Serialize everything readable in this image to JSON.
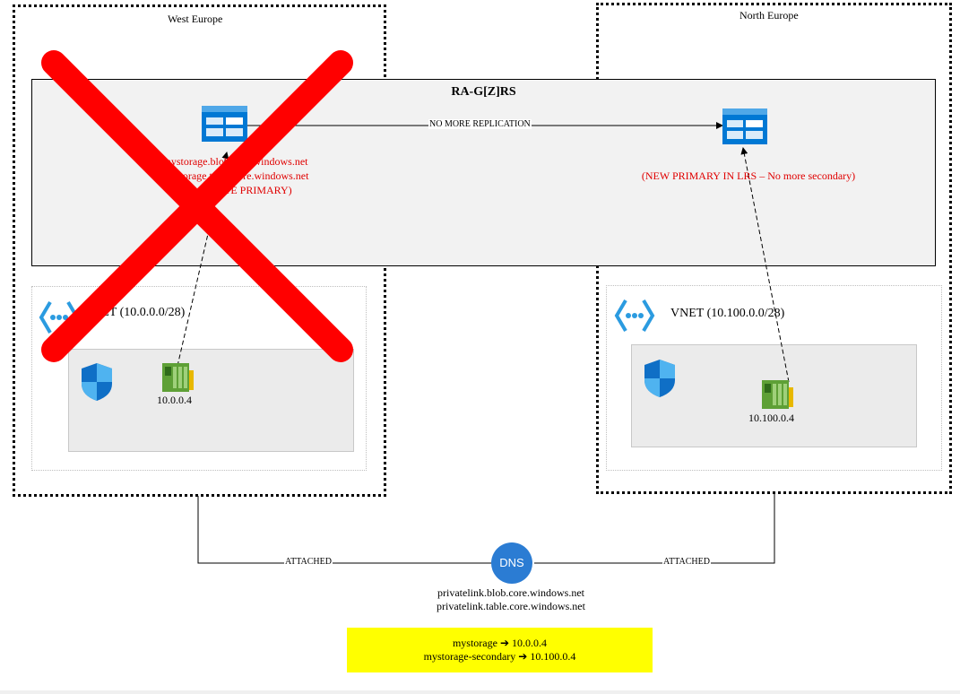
{
  "regions": {
    "west": {
      "label": "West Europe"
    },
    "north": {
      "label": "North Europe"
    }
  },
  "replication": {
    "title": "RA-G[Z]RS",
    "link_label": "NO MORE REPLICATION"
  },
  "west_storage": {
    "lines": [
      "mystorage.blob.core.windows.net",
      "mystorage.table.core.windows.net",
      "(OBSOLETE PRIMARY)"
    ]
  },
  "north_storage": {
    "status": "(NEW PRIMARY IN LRS – No more secondary)"
  },
  "west_vnet": {
    "label": "VNET (10.0.0.0/28)",
    "nic_ip": "10.0.0.4"
  },
  "north_vnet": {
    "label": "VNET (10.100.0.0/28)",
    "nic_ip": "10.100.0.4"
  },
  "dns": {
    "icon_text": "DNS",
    "attached_left": "ATTACHED",
    "attached_right": "ATTACHED",
    "zones": [
      "privatelink.blob.core.windows.net",
      "privatelink.table.core.windows.net"
    ]
  },
  "mapping": {
    "rows": [
      {
        "name": "mystorage",
        "arrow": "➔",
        "ip": "10.0.0.4"
      },
      {
        "name": "mystorage-secondary",
        "arrow": "➔",
        "ip": "10.100.0.4"
      }
    ]
  },
  "colors": {
    "failure_cross": "#ff0000",
    "status_text": "#e00000",
    "storage_blue": "#0078d4",
    "dns_blue": "#2b7cd3",
    "highlight": "#ffff00",
    "nic_green": "#5ea036"
  }
}
